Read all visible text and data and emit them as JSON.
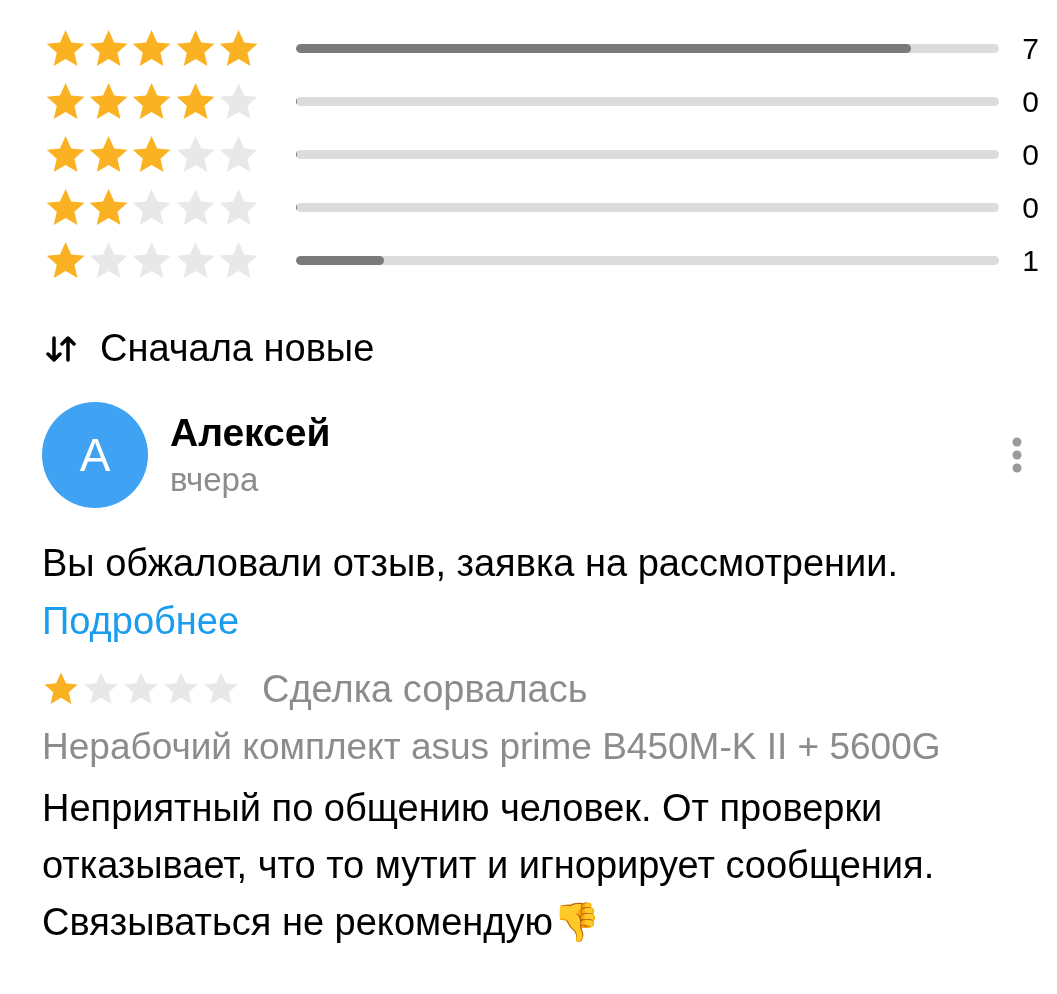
{
  "ratings": [
    {
      "stars": 5,
      "level": 0.875,
      "count": "7"
    },
    {
      "stars": 4,
      "level": 0,
      "count": "0"
    },
    {
      "stars": 3,
      "level": 0,
      "count": "0"
    },
    {
      "stars": 2,
      "level": 0,
      "count": "0"
    },
    {
      "stars": 1,
      "level": 0.125,
      "count": "1"
    }
  ],
  "sort": {
    "label": "Сначала новые"
  },
  "review": {
    "avatar_letter": "А",
    "author": "Алексей",
    "date": "вчера",
    "appeal_notice": "Вы обжаловали отзыв, заявка на рассмотрении.",
    "more_link": "Подробнее",
    "stars": 1,
    "deal_status": "Сделка сорвалась",
    "item": "Нерабочий комплект asus prime B450M-K II + 5600G",
    "text": "Неприятный по общению человек. От проверки отказывает, что то мутит и игнорирует сообщения. Связываться не рекомендую👎"
  }
}
